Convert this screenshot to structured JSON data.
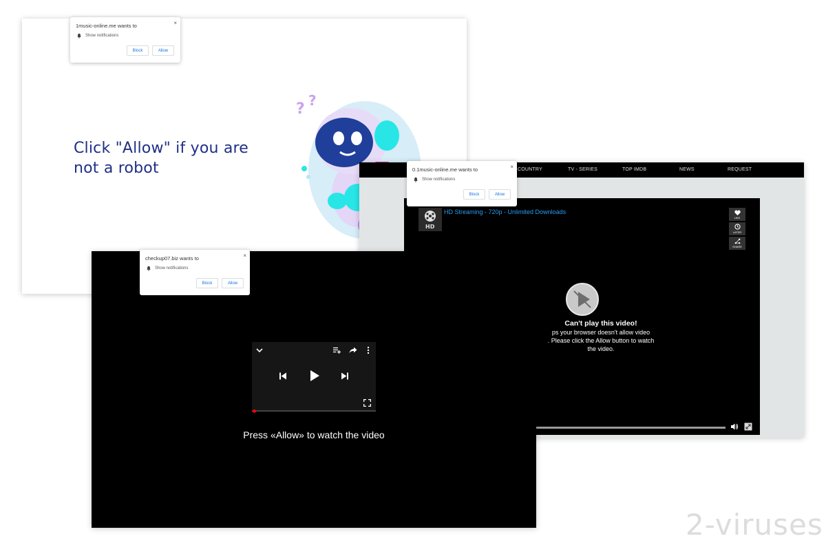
{
  "screenshot_1": {
    "headline_line1": "Click \"Allow\" if you are",
    "headline_line2": "not a robot",
    "notification": {
      "site": "1music-online.me wants to",
      "body": "Show notifications",
      "block_label": "Block",
      "allow_label": "Allow",
      "close_label": "×"
    }
  },
  "screenshot_2": {
    "nav": [
      "COUNTRY",
      "TV - SERIES",
      "TOP IMDB",
      "NEWS",
      "REQUEST"
    ],
    "notification": {
      "site": "0.1music-online.me wants to",
      "body": "Show notifications",
      "block_label": "Block",
      "allow_label": "Allow",
      "close_label": "×"
    },
    "video_title": "HD Streaming - 720p - Unlimited Downloads",
    "side_buttons": [
      "LIKE",
      "LATER",
      "SHARE"
    ],
    "error_title": "Can't play this video!",
    "error_lines": [
      "ps your browser doesn't allow video",
      ". Please click the Allow button to watch",
      "the video."
    ]
  },
  "screenshot_3": {
    "notification": {
      "site": "checkup07.biz wants to",
      "body": "Show notifications",
      "block_label": "Block",
      "allow_label": "Allow",
      "close_label": "×"
    },
    "caption": "Press «Allow» to watch the video"
  },
  "watermark": "2-viruses"
}
